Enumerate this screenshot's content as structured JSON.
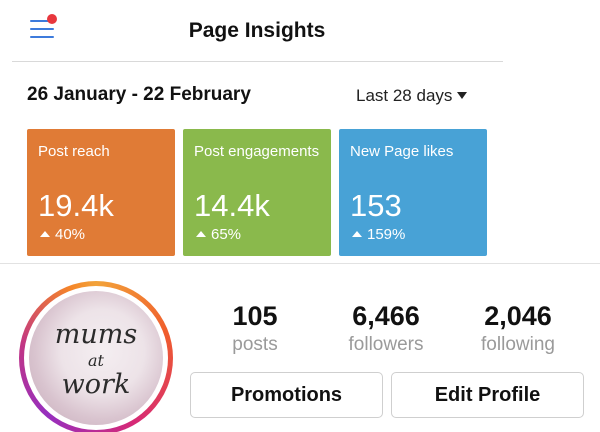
{
  "header": {
    "title": "Page Insights"
  },
  "insights": {
    "date_range": "26 January - 22 February",
    "period": "Last 28 days",
    "tiles": [
      {
        "label": "Post reach",
        "value": "19.4k",
        "change": "40%",
        "color": "#e07b36"
      },
      {
        "label": "Post engagements",
        "value": "14.4k",
        "change": "65%",
        "color": "#8ab94c"
      },
      {
        "label": "New Page likes",
        "value": "153",
        "change": "159%",
        "color": "#48a2d6"
      }
    ]
  },
  "profile": {
    "avatar_text": [
      "mums",
      "at",
      "work"
    ],
    "stats": [
      {
        "value": "105",
        "label": "posts"
      },
      {
        "value": "6,466",
        "label": "followers"
      },
      {
        "value": "2,046",
        "label": "following"
      }
    ],
    "buttons": {
      "promotions": "Promotions",
      "edit_profile": "Edit Profile"
    }
  },
  "colors": {
    "accent": "#3d7bdc",
    "notification": "#e8373d"
  }
}
